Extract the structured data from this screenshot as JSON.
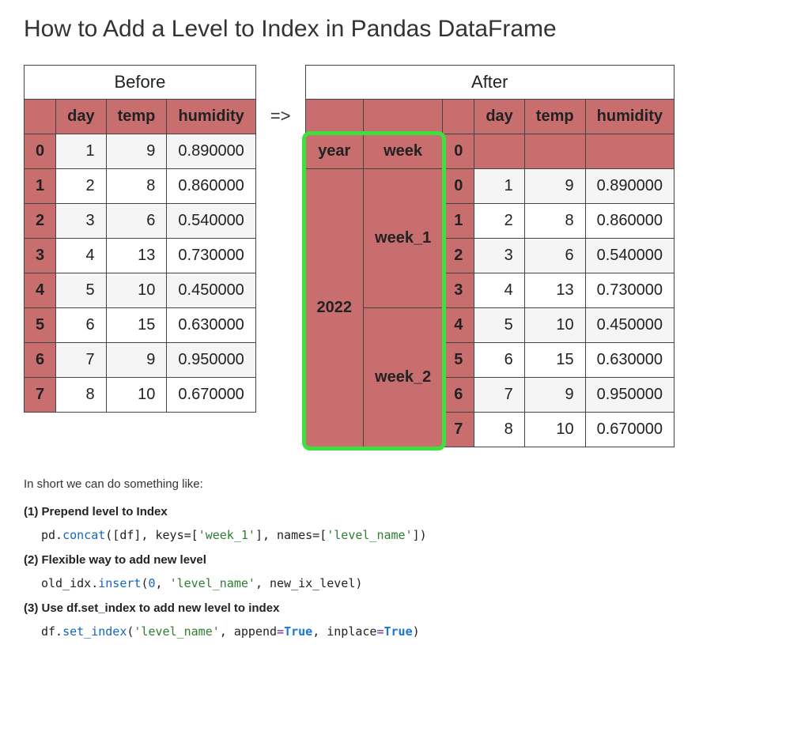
{
  "title": "How to Add a Level to Index in Pandas DataFrame",
  "arrow": "=>",
  "before": {
    "caption": "Before",
    "columns": [
      "day",
      "temp",
      "humidity"
    ],
    "rows": [
      {
        "idx": "0",
        "day": "1",
        "temp": "9",
        "humidity": "0.890000"
      },
      {
        "idx": "1",
        "day": "2",
        "temp": "8",
        "humidity": "0.860000"
      },
      {
        "idx": "2",
        "day": "3",
        "temp": "6",
        "humidity": "0.540000"
      },
      {
        "idx": "3",
        "day": "4",
        "temp": "13",
        "humidity": "0.730000"
      },
      {
        "idx": "4",
        "day": "5",
        "temp": "10",
        "humidity": "0.450000"
      },
      {
        "idx": "5",
        "day": "6",
        "temp": "15",
        "humidity": "0.630000"
      },
      {
        "idx": "6",
        "day": "7",
        "temp": "9",
        "humidity": "0.950000"
      },
      {
        "idx": "7",
        "day": "8",
        "temp": "10",
        "humidity": "0.670000"
      }
    ]
  },
  "after": {
    "caption": "After",
    "columns": [
      "day",
      "temp",
      "humidity"
    ],
    "index_names": [
      "year",
      "week"
    ],
    "year": "2022",
    "weeks": [
      "week_1",
      "week_2"
    ],
    "rows": [
      {
        "idx": "0",
        "day": "1",
        "temp": "9",
        "humidity": "0.890000"
      },
      {
        "idx": "1",
        "day": "2",
        "temp": "8",
        "humidity": "0.860000"
      },
      {
        "idx": "2",
        "day": "3",
        "temp": "6",
        "humidity": "0.540000"
      },
      {
        "idx": "3",
        "day": "4",
        "temp": "13",
        "humidity": "0.730000"
      },
      {
        "idx": "4",
        "day": "5",
        "temp": "10",
        "humidity": "0.450000"
      },
      {
        "idx": "5",
        "day": "6",
        "temp": "15",
        "humidity": "0.630000"
      },
      {
        "idx": "6",
        "day": "7",
        "temp": "9",
        "humidity": "0.950000"
      },
      {
        "idx": "7",
        "day": "8",
        "temp": "10",
        "humidity": "0.670000"
      }
    ],
    "name_row_idx": "0"
  },
  "explain_text": "In short we can do something like:",
  "sections": [
    {
      "title": "(1) Prepend level to Index",
      "code": {
        "pre1": "pd.",
        "fn": "concat",
        "mid1": "([df], keys=[",
        "str1": "'week_1'",
        "mid2": "], names=[",
        "str2": "'level_name'",
        "post": "])"
      }
    },
    {
      "title": "(2) Flexible way to add new level",
      "code": {
        "pre1": "old_idx.",
        "fn": "insert",
        "mid1": "(",
        "num": "0",
        "mid2": ", ",
        "str1": "'level_name'",
        "post": ", new_ix_level)"
      }
    },
    {
      "title": "(3) Use df.set_index to add new level to index",
      "code": {
        "pre1": "df.",
        "fn": "set_index",
        "mid1": "(",
        "str1": "'level_name'",
        "mid2": ", append",
        "op1": "=",
        "kw1": "True",
        "mid3": ", inplace",
        "op2": "=",
        "kw2": "True",
        "post": ")"
      }
    }
  ]
}
